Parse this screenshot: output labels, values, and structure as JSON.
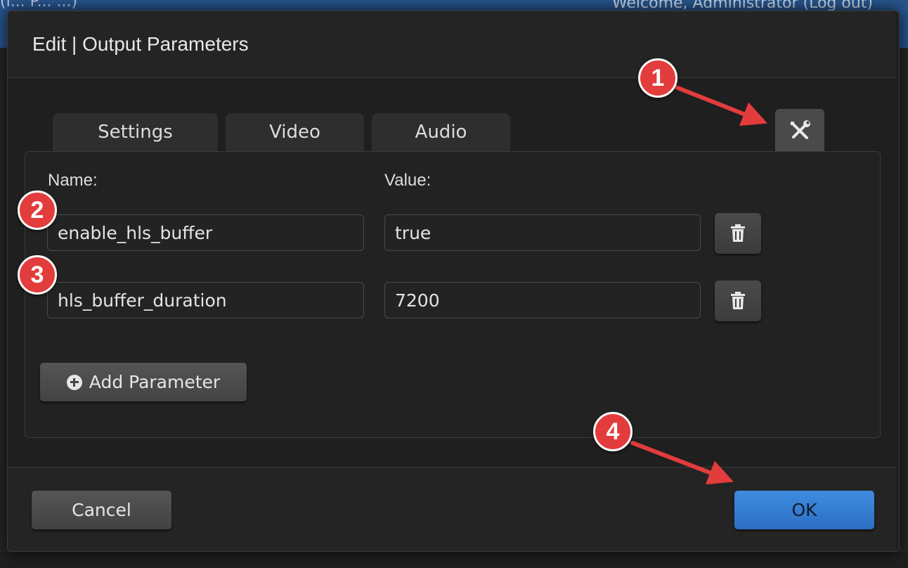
{
  "background": {
    "topbar_left": "(l...    P...    ...)",
    "topbar_right": "Welcome, Administrator   (Log out)"
  },
  "dialog": {
    "title": "Edit | Output Parameters",
    "tabs": [
      {
        "label": "Settings"
      },
      {
        "label": "Video"
      },
      {
        "label": "Audio"
      }
    ],
    "tools_icon": "tools-icon",
    "columns": {
      "name": "Name:",
      "value": "Value:"
    },
    "parameters": [
      {
        "name": "enable_hls_buffer",
        "value": "true"
      },
      {
        "name": "hls_buffer_duration",
        "value": "7200"
      }
    ],
    "add_label": "Add Parameter",
    "cancel_label": "Cancel",
    "ok_label": "OK"
  },
  "annotations": [
    {
      "label": "1"
    },
    {
      "label": "2"
    },
    {
      "label": "3"
    },
    {
      "label": "4"
    }
  ],
  "colors": {
    "accent": "#3a83d9",
    "annotation": "#e23c3c",
    "dialog_bg": "#1f1f1f"
  }
}
